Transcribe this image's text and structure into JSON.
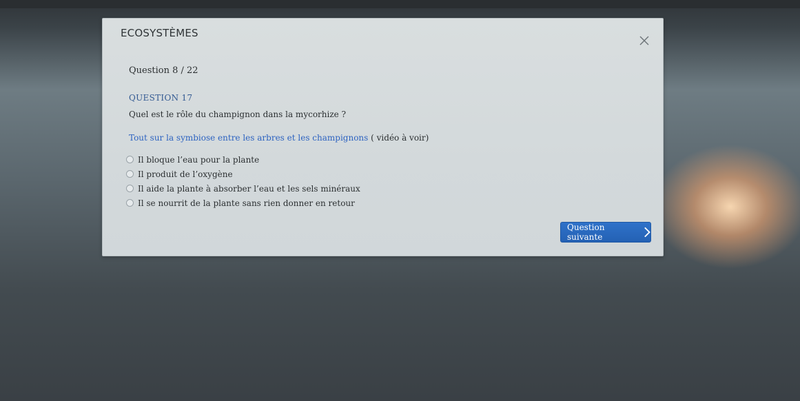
{
  "modal": {
    "title": "ECOSYSTÈMES",
    "close_icon": "close-icon",
    "question_counter": "Question 8 / 22",
    "question_label": "QUESTION 17",
    "question_text": "Quel est le rôle du champignon dans la mycorhize ?",
    "resource": {
      "link_text": "Tout sur la symbiose entre les arbres et les champignons",
      "suffix": " ( vidéo à voir)"
    },
    "options": [
      {
        "label": "Il bloque l’eau pour la plante"
      },
      {
        "label": "Il produit de l’oxygène"
      },
      {
        "label": "Il aide la plante à absorber l’eau et les sels minéraux"
      },
      {
        "label": "Il se nourrit de la plante sans rien donner en retour"
      }
    ],
    "next_button": {
      "label": "Question suivante",
      "icon": "chevron-right-icon"
    }
  },
  "colors": {
    "link": "#2d63c1",
    "button": "#2a69bf",
    "question_label": "#335a92"
  }
}
